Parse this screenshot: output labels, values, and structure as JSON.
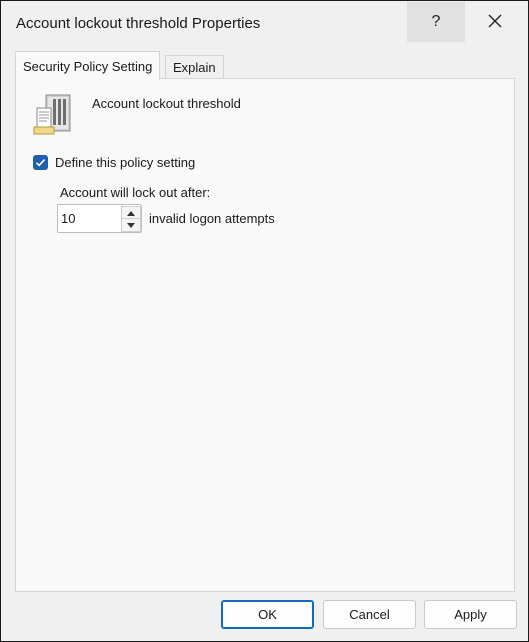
{
  "window": {
    "title": "Account lockout threshold Properties",
    "help_label": "?",
    "close_icon": "close-icon"
  },
  "tabs": [
    {
      "label": "Security Policy Setting",
      "active": true
    },
    {
      "label": "Explain",
      "active": false
    }
  ],
  "policy": {
    "icon": "server-policy-icon",
    "name": "Account lockout threshold"
  },
  "define_setting": {
    "label": "Define this policy setting",
    "checked": true
  },
  "lockout": {
    "prompt": "Account will lock out after:",
    "value": "10",
    "suffix": "invalid logon attempts"
  },
  "buttons": {
    "ok": "OK",
    "cancel": "Cancel",
    "apply": "Apply"
  },
  "colors": {
    "accent": "#1e5fae",
    "default_button_border": "#0f6cbd",
    "background": "#f0f0f0"
  }
}
